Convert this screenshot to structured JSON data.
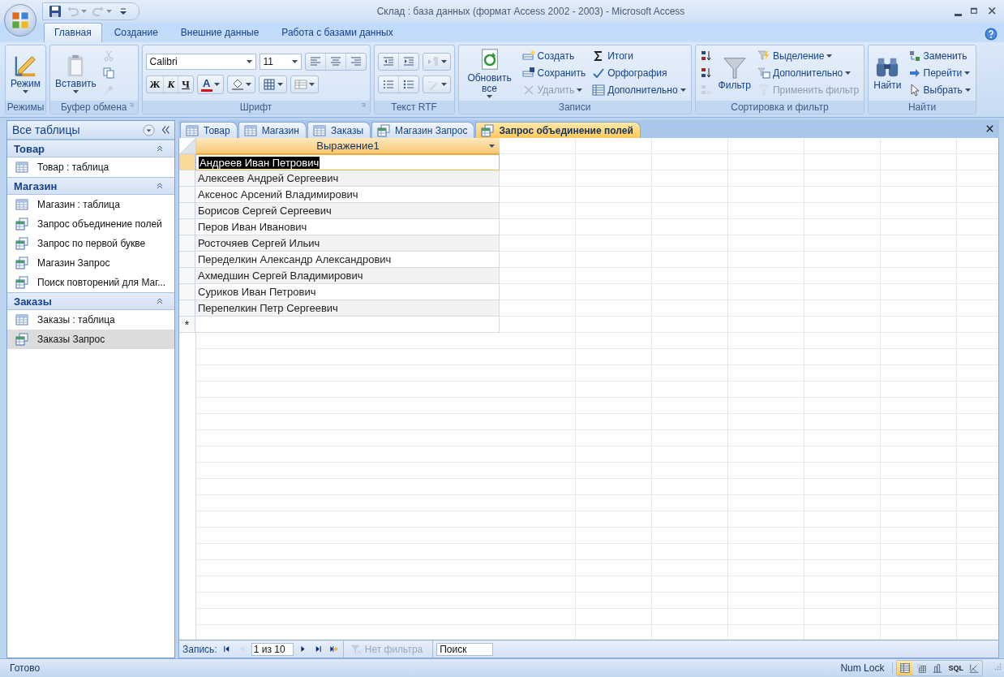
{
  "window": {
    "title": "Склад : база данных (формат Access 2002 - 2003) - Microsoft Access"
  },
  "quick_access": [
    {
      "kind": "save",
      "disabled": false
    },
    {
      "kind": "undo",
      "disabled": true
    },
    {
      "kind": "redo",
      "disabled": true
    },
    {
      "kind": "customize",
      "disabled": false
    }
  ],
  "ribbon_tabs": [
    {
      "label": "Главная",
      "selected": true
    },
    {
      "label": "Создание",
      "selected": false
    },
    {
      "label": "Внешние данные",
      "selected": false
    },
    {
      "label": "Работа с базами данных",
      "selected": false
    }
  ],
  "ribbon_groups": [
    {
      "label": "Режимы",
      "launcher": false,
      "kind": "columns",
      "columns": [
        [
          {
            "kind": "large",
            "label": "Режим",
            "dropdown": true,
            "disabled": false
          }
        ]
      ]
    },
    {
      "label": "Буфер обмена",
      "launcher": true,
      "kind": "columns",
      "columns": [
        [
          {
            "kind": "large",
            "label": "Вставить",
            "dropdown": true,
            "disabled": false
          }
        ],
        [
          {
            "kind": "icon",
            "dropdown": false,
            "disabled": true
          },
          {
            "kind": "icon",
            "dropdown": false,
            "disabled": false
          },
          {
            "kind": "icon",
            "dropdown": false,
            "disabled": true
          }
        ]
      ]
    },
    {
      "label": "Шрифт",
      "launcher": true,
      "kind": "rows",
      "rows": [
        [
          {
            "kind": "font-box",
            "value": "Calibri"
          },
          {
            "kind": "size-box",
            "value": "11"
          },
          {
            "kind": "segment",
            "buttons": [
              {
                "kind": "icon",
                "dropdown": false,
                "disabled": false
              },
              {
                "kind": "icon",
                "dropdown": false,
                "disabled": false
              },
              {
                "kind": "icon",
                "dropdown": false,
                "disabled": false
              }
            ]
          }
        ],
        [
          {
            "kind": "segment",
            "buttons": [
              {
                "kind": "bold",
                "label": "Ж",
                "dropdown": false,
                "disabled": false
              },
              {
                "kind": "italic",
                "label": "К",
                "dropdown": false,
                "disabled": false
              },
              {
                "kind": "underline",
                "label": "Ч",
                "dropdown": false,
                "disabled": false
              }
            ]
          },
          {
            "kind": "segment",
            "buttons": [
              {
                "kind": "font-color",
                "label": "A",
                "dropdown": true,
                "disabled": false
              }
            ]
          },
          {
            "kind": "segment",
            "buttons": [
              {
                "kind": "icon",
                "dropdown": true,
                "disabled": false
              }
            ]
          },
          {
            "kind": "segment",
            "buttons": [
              {
                "kind": "icon",
                "dropdown": true,
                "disabled": false
              }
            ]
          },
          {
            "kind": "segment",
            "buttons": [
              {
                "kind": "icon",
                "dropdown": true,
                "disabled": false
              }
            ]
          }
        ]
      ]
    },
    {
      "label": "Текст RTF",
      "launcher": false,
      "kind": "rows",
      "rows": [
        [
          {
            "kind": "segment",
            "buttons": [
              {
                "kind": "icon",
                "dropdown": false,
                "disabled": false
              },
              {
                "kind": "icon",
                "dropdown": false,
                "disabled": false
              }
            ]
          },
          {
            "kind": "segment",
            "buttons": [
              {
                "kind": "icon",
                "dropdown": true,
                "disabled": true
              }
            ]
          }
        ],
        [
          {
            "kind": "segment",
            "buttons": [
              {
                "kind": "icon",
                "dropdown": false,
                "disabled": false
              },
              {
                "kind": "icon",
                "dropdown": false,
                "disabled": false
              }
            ]
          },
          {
            "kind": "segment",
            "buttons": [
              {
                "kind": "icon",
                "dropdown": true,
                "disabled": true
              }
            ]
          }
        ]
      ]
    },
    {
      "label": "Записи",
      "launcher": false,
      "kind": "columns",
      "columns": [
        [
          {
            "kind": "large",
            "label": "Обновить все",
            "dropdown": true,
            "disabled": false
          }
        ],
        [
          {
            "kind": "small",
            "label": "Создать",
            "dropdown": false,
            "disabled": false
          },
          {
            "kind": "small",
            "label": "Сохранить",
            "dropdown": false,
            "disabled": false
          },
          {
            "kind": "small",
            "label": "Удалить",
            "dropdown": true,
            "disabled": true
          }
        ],
        [
          {
            "kind": "small",
            "label": "Итоги",
            "dropdown": false,
            "disabled": false
          },
          {
            "kind": "small",
            "label": "Орфография",
            "dropdown": false,
            "disabled": false
          },
          {
            "kind": "small",
            "label": "Дополнительно",
            "dropdown": true,
            "disabled": false
          }
        ]
      ]
    },
    {
      "label": "Сортировка и фильтр",
      "launcher": false,
      "kind": "columns",
      "columns": [
        [
          {
            "kind": "icon",
            "dropdown": false,
            "disabled": false
          },
          {
            "kind": "icon",
            "dropdown": false,
            "disabled": false
          },
          {
            "kind": "icon",
            "dropdown": false,
            "disabled": true
          }
        ],
        [
          {
            "kind": "large",
            "label": "Фильтр",
            "dropdown": false,
            "disabled": false
          }
        ],
        [
          {
            "kind": "small",
            "label": "Выделение",
            "dropdown": true,
            "disabled": false
          },
          {
            "kind": "small",
            "label": "Дополнительно",
            "dropdown": true,
            "disabled": false
          },
          {
            "kind": "small",
            "label": "Применить фильтр",
            "dropdown": false,
            "disabled": true
          }
        ]
      ]
    },
    {
      "label": "Найти",
      "launcher": false,
      "kind": "columns",
      "columns": [
        [
          {
            "kind": "large",
            "label": "Найти",
            "dropdown": false,
            "disabled": false
          }
        ],
        [
          {
            "kind": "small",
            "label": "Заменить",
            "dropdown": false,
            "disabled": false
          },
          {
            "kind": "small",
            "label": "Перейти",
            "dropdown": true,
            "disabled": false
          },
          {
            "kind": "small",
            "label": "Выбрать",
            "dropdown": true,
            "disabled": false
          }
        ]
      ]
    }
  ],
  "nav_pane": {
    "title": "Все таблицы",
    "groups": [
      {
        "label": "Товар",
        "expanded": true,
        "items": [
          {
            "label": "Товар : таблица",
            "kind": "table",
            "selected": false
          }
        ]
      },
      {
        "label": "Магазин",
        "expanded": true,
        "items": [
          {
            "label": "Магазин : таблица",
            "kind": "table",
            "selected": false
          },
          {
            "label": "Запрос объединение полей",
            "kind": "query",
            "selected": false
          },
          {
            "label": "Запрос по первой букве",
            "kind": "query",
            "selected": false
          },
          {
            "label": "Магазин Запрос",
            "kind": "query",
            "selected": false
          },
          {
            "label": "Поиск повторений для Маг...",
            "kind": "query",
            "selected": false
          }
        ]
      },
      {
        "label": "Заказы",
        "expanded": true,
        "items": [
          {
            "label": "Заказы : таблица",
            "kind": "table",
            "selected": false
          },
          {
            "label": "Заказы Запрос",
            "kind": "query",
            "selected": true
          }
        ]
      }
    ]
  },
  "doc_tabs": [
    {
      "label": "Товар",
      "kind": "table",
      "selected": false
    },
    {
      "label": "Магазин",
      "kind": "table",
      "selected": false
    },
    {
      "label": "Заказы",
      "kind": "table",
      "selected": false
    },
    {
      "label": "Магазин Запрос",
      "kind": "query",
      "selected": false
    },
    {
      "label": "Запрос объединение полей",
      "kind": "query",
      "selected": true
    }
  ],
  "datasheet": {
    "columns": [
      "Выражение1"
    ],
    "rows": [
      {
        "cells": [
          "Андреев Иван Петрович"
        ],
        "selected": true
      },
      {
        "cells": [
          "Алексеев Андрей Сергеевич"
        ],
        "selected": false
      },
      {
        "cells": [
          "Аксенос Арсений Владимирович"
        ],
        "selected": false
      },
      {
        "cells": [
          "Борисов Сергей Сергеевич"
        ],
        "selected": false
      },
      {
        "cells": [
          "Перов Иван Иванович"
        ],
        "selected": false
      },
      {
        "cells": [
          "Росточяев Сергей Ильич"
        ],
        "selected": false
      },
      {
        "cells": [
          "Переделкин Александр Александрович"
        ],
        "selected": false
      },
      {
        "cells": [
          "Ахмедшин Сергей Владимирович"
        ],
        "selected": false
      },
      {
        "cells": [
          "Суриков Иван Петрович"
        ],
        "selected": false
      },
      {
        "cells": [
          "Перепелкин Петр Сергеевич"
        ],
        "selected": false
      }
    ],
    "new_row_marker": "*"
  },
  "record_nav": {
    "label": "Запись:",
    "position": "1 из 10",
    "buttons": [
      {
        "kind": "first",
        "disabled": false
      },
      {
        "kind": "prev",
        "disabled": true
      },
      {
        "kind": "next",
        "disabled": false
      },
      {
        "kind": "last",
        "disabled": false
      },
      {
        "kind": "new",
        "disabled": false
      }
    ],
    "filter": {
      "label": "Нет фильтра",
      "disabled": true
    },
    "search": {
      "placeholder": "Поиск"
    }
  },
  "status_bar": {
    "text": "Готово",
    "indicator": "Num Lock",
    "views": [
      {
        "kind": "datasheet",
        "selected": true
      },
      {
        "kind": "pivot-table",
        "selected": false
      },
      {
        "kind": "pivot-chart",
        "selected": false
      },
      {
        "kind": "sql",
        "label": "SQL",
        "selected": false
      },
      {
        "kind": "design",
        "selected": false
      }
    ]
  }
}
